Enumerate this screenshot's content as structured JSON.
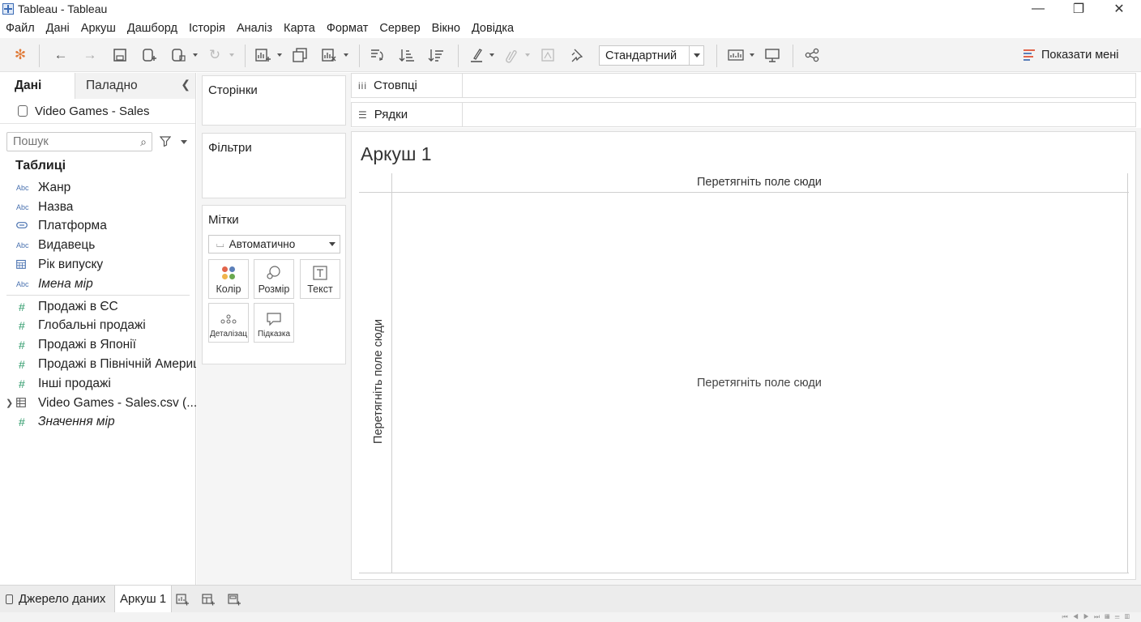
{
  "window": {
    "title": "Tableau - Tableau",
    "minimize": "—",
    "restore": "❐",
    "close": "✕"
  },
  "menu": [
    "Файл",
    "Дані",
    "Аркуш",
    "Дашборд",
    "Історія",
    "Аналіз",
    "Карта",
    "Формат",
    "Сервер",
    "Вікно",
    "Довідка"
  ],
  "toolbar": {
    "fit_value": "Стандартний",
    "show_me_label": "Показати мені"
  },
  "data_pane": {
    "tab_data": "Дані",
    "tab_analytics": "Паладно",
    "datasource_name": "Video Games - Sales",
    "search_placeholder": "Пошук",
    "tables_header": "Таблиці",
    "dimensions": [
      {
        "type": "Abc",
        "label": "Жанр"
      },
      {
        "type": "Abc",
        "label": "Назва"
      },
      {
        "type": "geo",
        "label": "Платформа"
      },
      {
        "type": "Abc",
        "label": "Видавець"
      },
      {
        "type": "cal",
        "label": "Рік випуску"
      },
      {
        "type": "Abc",
        "label": "Імена мір"
      }
    ],
    "measures": [
      {
        "type": "#",
        "label": "Продажі в ЄС"
      },
      {
        "type": "#",
        "label": "Глобальні продажі"
      },
      {
        "type": "#",
        "label": "Продажі в Японії"
      },
      {
        "type": "#",
        "label": "Продажі в Північній Америці"
      },
      {
        "type": "#",
        "label": "Інші продажі"
      },
      {
        "type": "table",
        "label": "Video Games - Sales.csv (..."
      },
      {
        "type": "#",
        "label": "Значення мір"
      }
    ]
  },
  "shelves": {
    "pages": "Сторінки",
    "filters": "Фільтри",
    "marks": "Мітки",
    "marks_type": "Автоматично",
    "mark_buttons": {
      "color": "Колір",
      "size": "Розмір",
      "text": "Текст",
      "detail": "Деталізац",
      "tooltip": "Підказка"
    },
    "columns": "Стовпці",
    "rows": "Рядки"
  },
  "view": {
    "sheet_title": "Аркуш 1",
    "drop_top": "Перетягніть поле сюди",
    "drop_center": "Перетягніть поле сюди",
    "drop_left": "Перетягніть поле сюди"
  },
  "bottom": {
    "datasource_tab": "Джерело даних",
    "sheet_tab": "Аркуш 1"
  },
  "colors": {
    "accent_blue": "#4a72b0",
    "measure_green": "#2e9a6a",
    "color_dots": [
      "#e2654b",
      "#5b7fb9",
      "#f0b44c",
      "#6aa84f"
    ]
  }
}
